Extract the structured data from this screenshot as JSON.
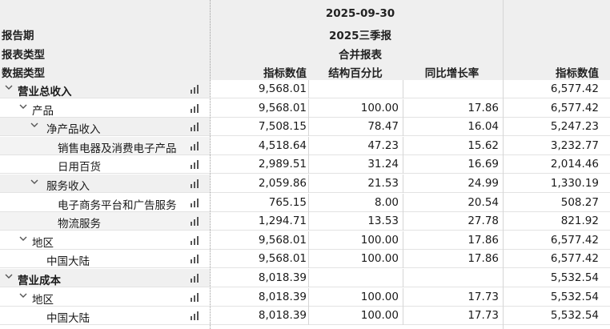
{
  "header": {
    "left_labels": [
      "报告期",
      "报表类型",
      "数据类型"
    ],
    "period": {
      "date": "2025-09-30",
      "report": "2025三季报",
      "statement": "合并报表"
    },
    "columns": [
      "指标数值",
      "结构百分比",
      "同比增长率",
      "指标数值"
    ]
  },
  "rows": [
    {
      "name": "营业总收入",
      "level": 0,
      "bold": true,
      "toggle": true,
      "v1": "9,568.01",
      "v2": "",
      "v3": "",
      "v4": "6,577.42"
    },
    {
      "name": "产品",
      "level": 1,
      "bold": false,
      "toggle": true,
      "v1": "9,568.01",
      "v2": "100.00",
      "v3": "17.86",
      "v4": "6,577.42"
    },
    {
      "name": "净产品收入",
      "level": 2,
      "bold": false,
      "toggle": true,
      "v1": "7,508.15",
      "v2": "78.47",
      "v3": "16.04",
      "v4": "5,247.23"
    },
    {
      "name": "销售电器及消费电子产品",
      "level": 3,
      "bold": false,
      "toggle": false,
      "v1": "4,518.64",
      "v2": "47.23",
      "v3": "15.62",
      "v4": "3,232.77"
    },
    {
      "name": "日用百货",
      "level": 3,
      "bold": false,
      "toggle": false,
      "v1": "2,989.51",
      "v2": "31.24",
      "v3": "16.69",
      "v4": "2,014.46"
    },
    {
      "name": "服务收入",
      "level": 2,
      "bold": false,
      "toggle": true,
      "v1": "2,059.86",
      "v2": "21.53",
      "v3": "24.99",
      "v4": "1,330.19"
    },
    {
      "name": "电子商务平台和广告服务",
      "level": 3,
      "bold": false,
      "toggle": false,
      "v1": "765.15",
      "v2": "8.00",
      "v3": "20.54",
      "v4": "508.27"
    },
    {
      "name": "物流服务",
      "level": 3,
      "bold": false,
      "toggle": false,
      "v1": "1,294.71",
      "v2": "13.53",
      "v3": "27.78",
      "v4": "821.92"
    },
    {
      "name": "地区",
      "level": 1,
      "bold": false,
      "toggle": true,
      "v1": "9,568.01",
      "v2": "100.00",
      "v3": "17.86",
      "v4": "6,577.42"
    },
    {
      "name": "中国大陆",
      "level": 2,
      "bold": false,
      "toggle": false,
      "v1": "9,568.01",
      "v2": "100.00",
      "v3": "17.86",
      "v4": "6,577.42"
    },
    {
      "name": "营业成本",
      "level": 0,
      "bold": true,
      "toggle": true,
      "v1": "8,018.39",
      "v2": "",
      "v3": "",
      "v4": "5,532.54"
    },
    {
      "name": "地区",
      "level": 1,
      "bold": false,
      "toggle": true,
      "v1": "8,018.39",
      "v2": "100.00",
      "v3": "17.73",
      "v4": "5,532.54"
    },
    {
      "name": "中国大陆",
      "level": 2,
      "bold": false,
      "toggle": false,
      "v1": "8,018.39",
      "v2": "100.00",
      "v3": "17.73",
      "v4": "5,532.54"
    }
  ]
}
